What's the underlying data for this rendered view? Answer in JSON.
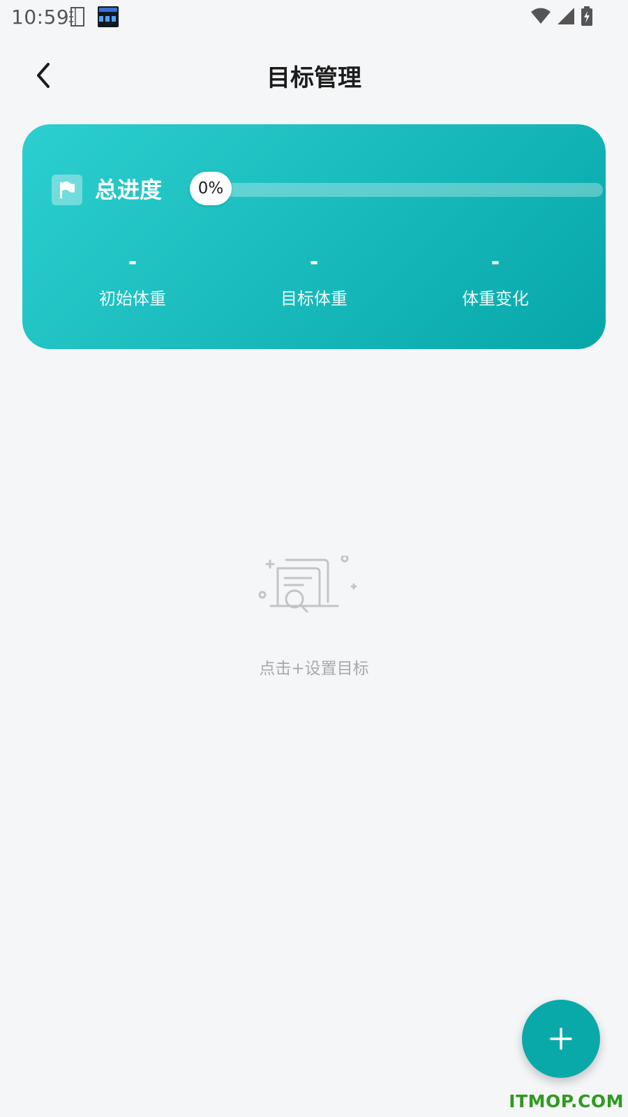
{
  "status_bar": {
    "time": "10:59",
    "icons": [
      "notebook-icon",
      "calendar-app-icon",
      "wifi-icon",
      "cellular-signal-icon",
      "battery-charging-icon"
    ]
  },
  "header": {
    "title": "目标管理",
    "back_icon": "chevron-left-icon"
  },
  "progress_card": {
    "label": "总进度",
    "icon": "flag-icon",
    "progress": 0,
    "progress_text": "0%",
    "stats": [
      {
        "value": "-",
        "label": "初始体重"
      },
      {
        "value": "-",
        "label": "目标体重"
      },
      {
        "value": "-",
        "label": "体重变化"
      }
    ],
    "gradient_start": "#2ccfcf",
    "gradient_end": "#07a7a9"
  },
  "empty_state": {
    "icon": "empty-document-search-icon",
    "hint": "点击+设置目标"
  },
  "fab": {
    "icon": "plus-icon",
    "color": "#0aa9a9"
  },
  "watermark": "ITMOP.COM"
}
